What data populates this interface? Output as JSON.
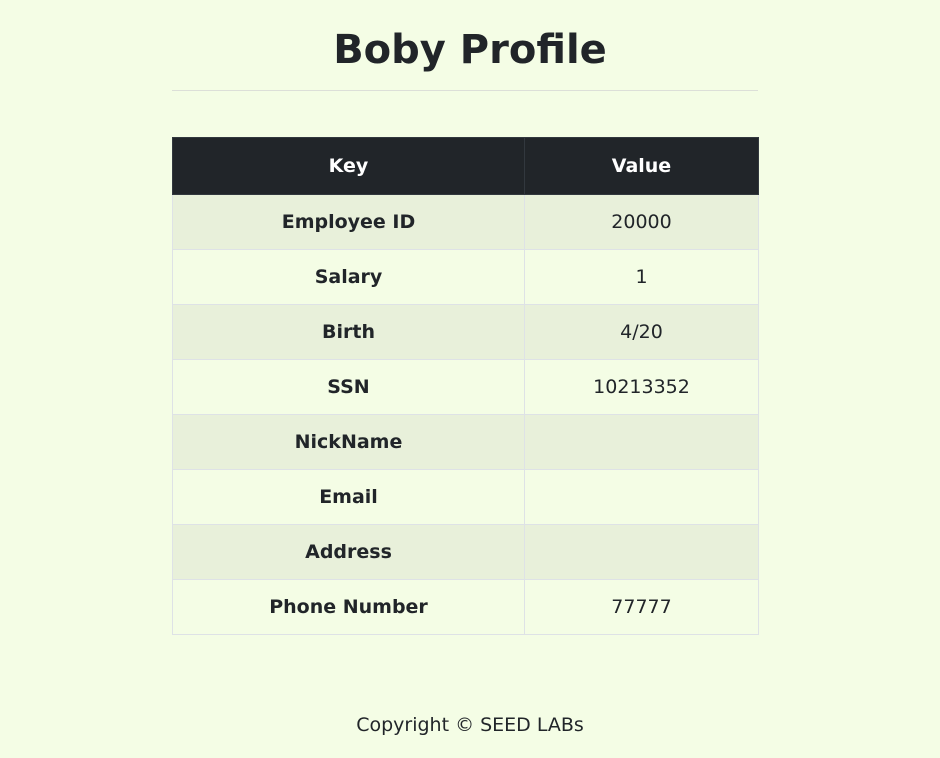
{
  "page": {
    "title": "Boby Profile"
  },
  "table": {
    "headers": {
      "key": "Key",
      "value": "Value"
    },
    "rows": [
      {
        "key": "Employee ID",
        "value": "20000"
      },
      {
        "key": "Salary",
        "value": "1"
      },
      {
        "key": "Birth",
        "value": "4/20"
      },
      {
        "key": "SSN",
        "value": "10213352"
      },
      {
        "key": "NickName",
        "value": ""
      },
      {
        "key": "Email",
        "value": ""
      },
      {
        "key": "Address",
        "value": ""
      },
      {
        "key": "Phone Number",
        "value": "77777"
      }
    ]
  },
  "footer": {
    "text": "Copyright © SEED LABs"
  },
  "colors": {
    "background": "#f4fde5",
    "header_background": "#212529",
    "striped_row": "#e8f0da",
    "text": "#212529"
  }
}
